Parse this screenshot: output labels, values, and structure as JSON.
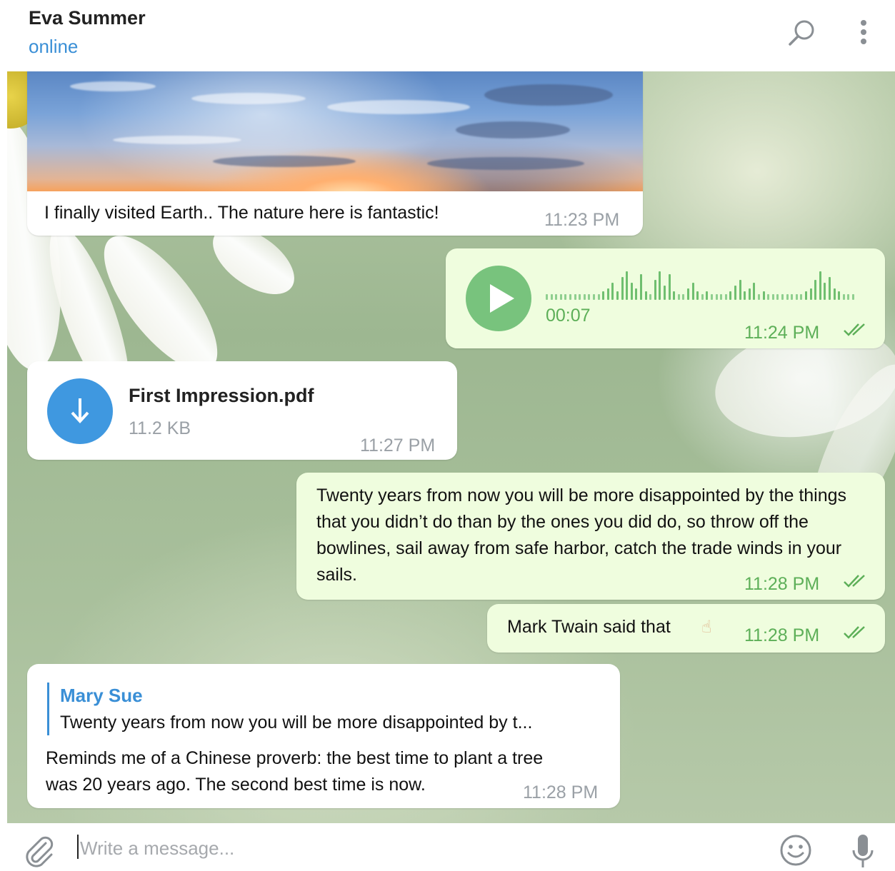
{
  "header": {
    "title": "Eva Summer",
    "status": "online",
    "search_icon": "search-icon",
    "more_icon": "more-vertical-icon"
  },
  "messages": {
    "photo_msg": {
      "caption": "I finally visited Earth.. The nature here is fantastic!",
      "time": "11:23 PM"
    },
    "voice_msg": {
      "duration": "00:07",
      "time": "11:24 PM",
      "status": "read"
    },
    "file_msg": {
      "file_name": "First Impression.pdf",
      "file_size": "11.2 KB",
      "time": "11:27 PM"
    },
    "quote_msg": {
      "text": "Twenty years from now you will be more disappointed by the things that you didn’t do than by the ones you did do, so throw off the bowlines, sail away from safe harbor, catch the trade winds in your sails.",
      "time": "11:28 PM",
      "status": "read"
    },
    "twain_msg": {
      "text": "Mark Twain said that",
      "emoji": "☝",
      "time": "11:28 PM",
      "status": "read"
    },
    "reply_msg": {
      "reply_author": "Mary Sue",
      "reply_preview": "Twenty years from now you will be more disappointed by t...",
      "text": "Reminds me of a Chinese proverb: the best time to plant a tree was 20 years ago. The second best time is now.",
      "time": "11:28 PM"
    }
  },
  "input": {
    "placeholder": "Write a message...",
    "value": ""
  },
  "colors": {
    "accent": "#3a8fd6",
    "outgoing_bubble": "#effdde",
    "outgoing_time": "#5daf58",
    "incoming_bubble": "#ffffff",
    "voice_button": "#78c37d",
    "download_button": "#3f98e0"
  }
}
